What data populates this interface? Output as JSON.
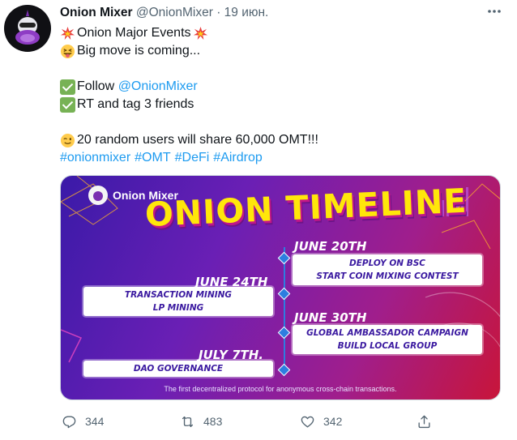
{
  "tweet": {
    "author_name": "Onion Mixer",
    "handle": "@OnionMixer",
    "separator": "·",
    "date": "19 июн.",
    "lines": {
      "l1": "Onion Major Events",
      "l2": "Big move is coming...",
      "l3_prefix": "Follow ",
      "l3_link": "@OnionMixer",
      "l4": "RT and tag 3 friends",
      "l5": "20 random users will share 60,000 OMT!!!"
    },
    "hashtags": [
      "#onionmixer",
      "#OMT",
      "#DeFi",
      "#Airdrop"
    ]
  },
  "media": {
    "brand": "Onion Mixer",
    "headline": "ONION TIMELINE",
    "events": [
      {
        "date": "JUNE 20TH",
        "items": [
          "DEPLOY ON BSC",
          "START COIN MIXING CONTEST"
        ]
      },
      {
        "date": "JUNE 24TH",
        "items": [
          "TRANSACTION MINING",
          "LP MINING"
        ]
      },
      {
        "date": "JUNE 30TH",
        "items": [
          "GLOBAL AMBASSADOR CAMPAIGN",
          "BUILD LOCAL GROUP"
        ]
      },
      {
        "date": "JULY 7TH.",
        "items": [
          "DAO GOVERNANCE"
        ]
      }
    ],
    "caption": "The first decentralized protocol for anonymous cross-chain transactions."
  },
  "actions": {
    "replies": "344",
    "retweets": "483",
    "likes": "342"
  },
  "icons": {
    "more": "more-dots-icon",
    "reply": "reply-icon",
    "retweet": "retweet-icon",
    "like": "heart-icon",
    "share": "share-icon"
  },
  "colors": {
    "link": "#1d9bf0",
    "muted": "#536471",
    "headline": "#ffe70a",
    "timeline": "#2d7de0"
  }
}
